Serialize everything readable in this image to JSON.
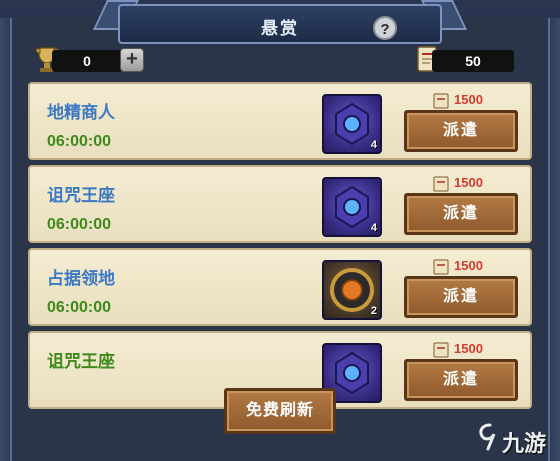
{
  "window": {
    "title": "悬赏",
    "help": "?"
  },
  "header": {
    "left_resource": {
      "value": "0",
      "icon": "trophy-icon"
    },
    "plus_label": "+",
    "right_resource": {
      "value": "50",
      "icon": "scroll-icon"
    }
  },
  "quests": [
    {
      "name": "地精商人",
      "name_color": "#3c79c4",
      "timer": "06:00:00",
      "item_qty": "4",
      "item_icon": "purple-rune-icon",
      "cost": "1500",
      "button": "派遣"
    },
    {
      "name": "诅咒王座",
      "name_color": "#3c79c4",
      "timer": "06:00:00",
      "item_qty": "4",
      "item_icon": "purple-rune-icon",
      "cost": "1500",
      "button": "派遣"
    },
    {
      "name": "占据领地",
      "name_color": "#3c79c4",
      "timer": "06:00:00",
      "item_qty": "2",
      "item_icon": "gold-rune-icon",
      "cost": "1500",
      "button": "派遣"
    },
    {
      "name": "诅咒王座",
      "name_color": "#3f8a1c",
      "timer": "",
      "item_qty": "",
      "item_icon": "purple-rune-icon",
      "cost": "1500",
      "button": "派遣"
    }
  ],
  "footer": {
    "refresh_label": "免费刷新"
  },
  "watermark": {
    "text": "九游"
  },
  "colors": {
    "cost": "#d83a2e",
    "timer": "#3f8a1c",
    "accent_button": "#a06a38"
  }
}
